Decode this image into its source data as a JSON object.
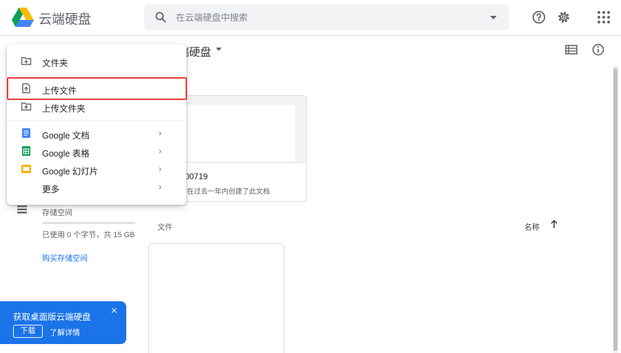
{
  "app": {
    "title": "云端硬盘"
  },
  "search": {
    "placeholder": "在云端硬盘中搜索"
  },
  "main": {
    "breadcrumb": "端硬盘",
    "quick_access": {
      "name": "000719",
      "subtitle": "你在过去一年内创建了此文档"
    },
    "files_label": "文件",
    "sort_label": "名称"
  },
  "sidebar": {
    "storage_label": "存储空间",
    "storage_used": "已使用 0 个字节，共 15 GB",
    "storage_used_fraction": 0,
    "buy_storage": "购买存储空间"
  },
  "promo": {
    "title": "获取桌面版云端硬盘",
    "close": "✕",
    "download": "下载",
    "learn_more": "了解详情"
  },
  "menu": {
    "new_folder": "文件夹",
    "upload_file": "上传文件",
    "upload_folder": "上传文件夹",
    "google_docs": "Google 文档",
    "google_sheets": "Google 表格",
    "google_slides": "Google 幻灯片",
    "more": "更多",
    "arrow": "›"
  },
  "colors": {
    "accent": "#1a73e8",
    "highlight": "#e53935",
    "docs": "#4285f4",
    "sheets": "#0f9d58",
    "slides": "#f4b400"
  }
}
